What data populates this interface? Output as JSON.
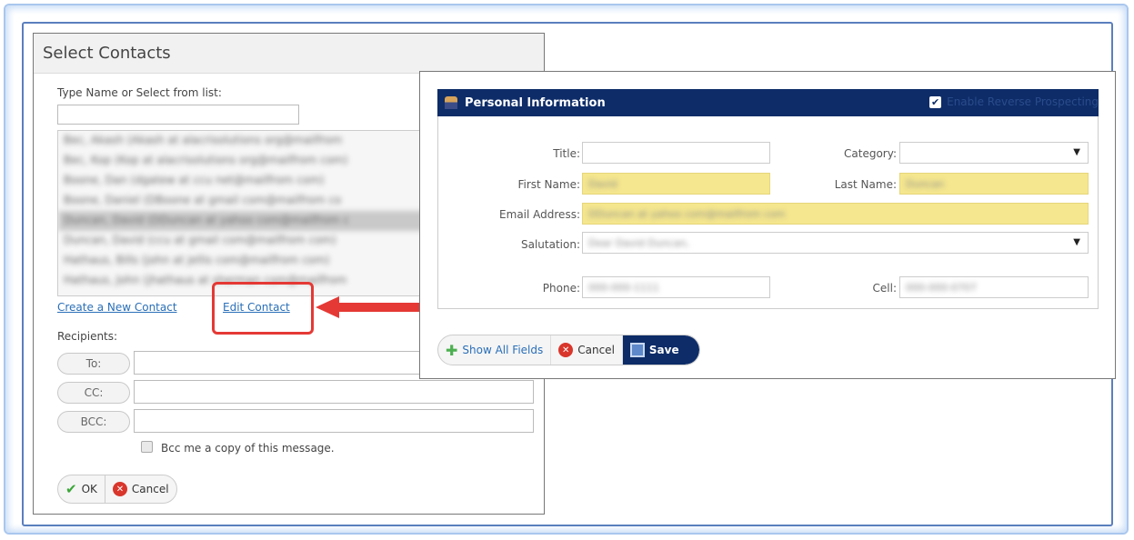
{
  "select_contacts": {
    "title": "Select Contacts",
    "type_name_label": "Type Name or Select from list:",
    "type_name_value": "",
    "contacts": [
      "Bec, Akash (Akash at alacrisolutions org@mailfrom",
      "Bec, Kop (Kop at alacrisolutions org@mailfrom com)",
      "Boone, Dan (dgatew at ccu net@mailfrom com)",
      "Boone, Daniel (DBoone at gmail com@mailfrom co",
      "Duncan, David (DDuncan at yahoo com@mailfrom c",
      "Duncan, David (ccu at gmail com@mailfrom com)",
      "Hathaus, Bills (john at jellis com@mailfrom com)",
      "Hathaus, John (jhathaus at sherman com@mailfrom"
    ],
    "selected_contact_index": 4,
    "create_link": "Create a New Contact",
    "edit_link": "Edit Contact",
    "recipients_label": "Recipients:",
    "to_label": "To:",
    "cc_label": "CC:",
    "bcc_label": "BCC:",
    "bcc_me_label": "Bcc me a copy of this message.",
    "ok_label": "OK",
    "cancel_label": "Cancel"
  },
  "personal_info": {
    "header": "Personal Information",
    "enable_reverse_label": "Enable Reverse Prospecting",
    "enable_reverse_checked": true,
    "title_label": "Title:",
    "title_value": "",
    "category_label": "Category:",
    "category_value": "",
    "first_name_label": "First Name:",
    "first_name_value": "David",
    "last_name_label": "Last Name:",
    "last_name_value": "Duncan",
    "email_label": "Email Address:",
    "email_value": "DDuncan at yahoo com@mailfrom com",
    "salutation_label": "Salutation:",
    "salutation_value": "Dear David Duncan,",
    "phone_label": "Phone:",
    "phone_value": "000-000-1111",
    "cell_label": "Cell:",
    "cell_value": "000-000-0707",
    "show_all_label": "Show All Fields",
    "cancel_label": "Cancel",
    "save_label": "Save"
  },
  "colors": {
    "header_bg": "#0d2c68",
    "highlight_yellow": "#f5e78f",
    "callout_red": "#e53935",
    "link_blue": "#2a6fb8"
  },
  "icons": {
    "person": "person-icon",
    "check": "check-icon",
    "cancel": "cancel-icon",
    "plus": "plus-icon",
    "save": "save-disk-icon",
    "dropdown": "chevron-down-icon",
    "callout_arrow": "arrow-left-icon"
  }
}
